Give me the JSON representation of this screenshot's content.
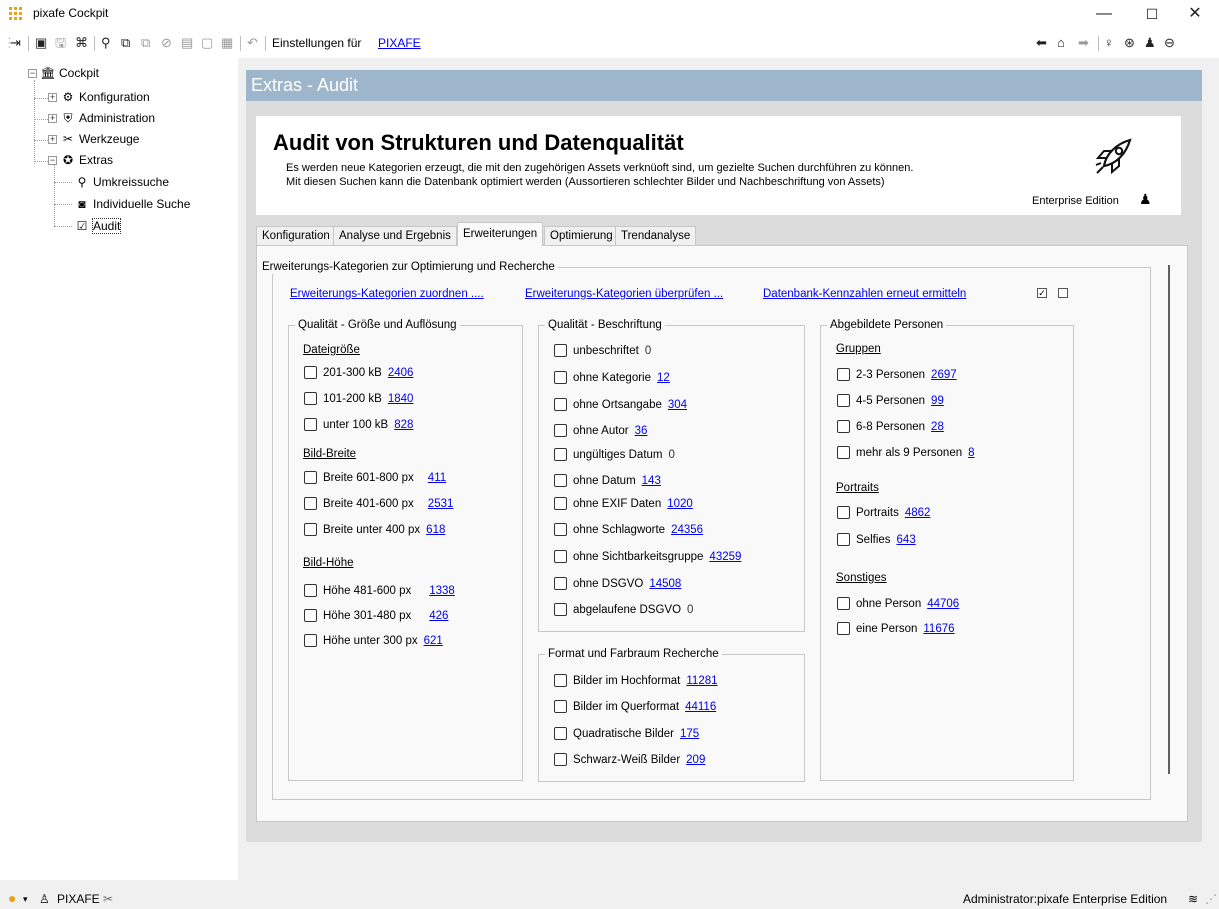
{
  "window": {
    "title": "pixafe Cockpit",
    "minimize": "—",
    "maximize": "☐",
    "close": "✕"
  },
  "toolbar": {
    "settings_label": "Einstellungen für",
    "settings_link": "PIXAFE"
  },
  "tree": {
    "root": "Cockpit",
    "items": [
      {
        "label": "Konfiguration"
      },
      {
        "label": "Administration"
      },
      {
        "label": "Werkzeuge"
      },
      {
        "label": "Extras"
      },
      {
        "label": "Umkreissuche"
      },
      {
        "label": "Individuelle Suche"
      },
      {
        "label": "Audit"
      }
    ]
  },
  "header": {
    "title": "Extras - Audit"
  },
  "banner": {
    "title": "Audit von Strukturen und Datenqualität",
    "line1": "Es werden neue Kategorien erzeugt, die mit den zugehörigen Assets verknüoft sind, um gezielte Suchen durchführen zu können.",
    "line2": "Mit diesen Suchen kann die Datenbank optimiert werden (Aussortieren schlechter Bilder und Nachbeschriftung von Assets)",
    "edition": "Enterprise Edition"
  },
  "tabs": [
    "Konfiguration",
    "Analyse und Ergebnis",
    "Erweiterungen",
    "Optimierung",
    "Trendanalyse"
  ],
  "outer_group": {
    "title": "Erweiterungs-Kategorien zur Optimierung und Recherche",
    "link1": "Erweiterungs-Kategorien zuordnen ....",
    "link2": "Erweiterungs-Kategorien überprüfen ...",
    "link3": "Datenbank-Kennzahlen erneut ermitteln"
  },
  "quality_size": {
    "title": "Qualität - Größe und Auflösung",
    "file_size": {
      "title": "Dateigröße",
      "items": [
        {
          "label": "201-300 kB",
          "count": "2406"
        },
        {
          "label": "101-200 kB",
          "count": "1840"
        },
        {
          "label": "unter 100 kB",
          "count": "828"
        }
      ]
    },
    "width": {
      "title": "Bild-Breite",
      "items": [
        {
          "label": "Breite 601-800 px",
          "count": "411"
        },
        {
          "label": "Breite 401-600 px",
          "count": "2531"
        },
        {
          "label": "Breite unter 400 px",
          "count": "618"
        }
      ]
    },
    "height": {
      "title": "Bild-Höhe",
      "items": [
        {
          "label": "Höhe 481-600 px",
          "count": "1338"
        },
        {
          "label": "Höhe 301-480 px",
          "count": "426"
        },
        {
          "label": "Höhe unter 300 px",
          "count": "621"
        }
      ]
    }
  },
  "quality_label": {
    "title": "Qualität - Beschriftung",
    "items": [
      {
        "label": "unbeschriftet",
        "count": "0"
      },
      {
        "label": "ohne Kategorie",
        "count": "12"
      },
      {
        "label": "ohne Ortsangabe",
        "count": "304"
      },
      {
        "label": "ohne Autor",
        "count": "36"
      },
      {
        "label": "ungültiges Datum",
        "count": "0"
      },
      {
        "label": "ohne Datum",
        "count": "143"
      },
      {
        "label": "ohne EXIF Daten",
        "count": "1020"
      },
      {
        "label": "ohne Schlagworte",
        "count": "24356"
      },
      {
        "label": "ohne Sichtbarkeitsgruppe",
        "count": "43259"
      },
      {
        "label": "ohne DSGVO",
        "count": "14508"
      },
      {
        "label": "abgelaufene DSGVO",
        "count": "0"
      }
    ]
  },
  "format": {
    "title": "Format und Farbraum Recherche",
    "items": [
      {
        "label": "Bilder im Hochformat",
        "count": "11281"
      },
      {
        "label": "Bilder im Querformat",
        "count": "44116"
      },
      {
        "label": "Quadratische Bilder",
        "count": "175"
      },
      {
        "label": "Schwarz-Weiß Bilder",
        "count": "209"
      }
    ]
  },
  "persons": {
    "title": "Abgebildete Personen",
    "groups": {
      "title": "Gruppen",
      "items": [
        {
          "label": "2-3 Personen",
          "count": "2697"
        },
        {
          "label": "4-5 Personen",
          "count": "99"
        },
        {
          "label": "6-8 Personen",
          "count": "28"
        },
        {
          "label": "mehr als 9 Personen",
          "count": "8"
        }
      ]
    },
    "portraits": {
      "title": "Portraits",
      "items": [
        {
          "label": "Portraits",
          "count": "4862"
        },
        {
          "label": "Selfies",
          "count": "643"
        }
      ]
    },
    "other": {
      "title": "Sonstiges",
      "items": [
        {
          "label": "ohne Person",
          "count": "44706"
        },
        {
          "label": "eine Person",
          "count": "11676"
        }
      ]
    }
  },
  "status": {
    "user": "PIXAFE",
    "right": "Administrator:pixafe  Enterprise Edition"
  },
  "colors": {
    "header_bar": "#9eb6cc",
    "link": "#0000ee",
    "accent": "#e8a317"
  }
}
